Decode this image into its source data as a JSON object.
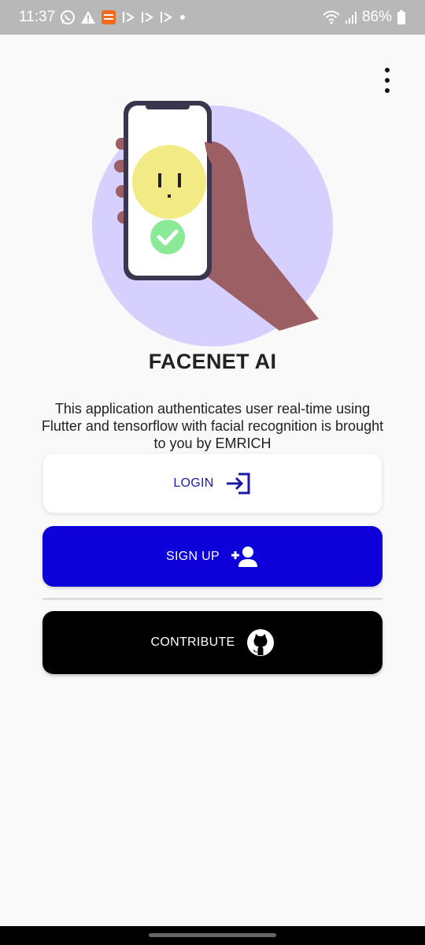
{
  "status_bar": {
    "time": "11:37",
    "battery": "86%",
    "icons": [
      "whatsapp-icon",
      "warning-icon",
      "app-notification-icon",
      "play-arrow-icon",
      "play-arrow-icon",
      "play-arrow-icon",
      "dot-icon",
      "wifi-icon",
      "signal-icon",
      "battery-icon"
    ]
  },
  "app_bar": {
    "menu_icon": "more-vert-icon"
  },
  "hero": {
    "illustration": "hand-holding-phone-face-check",
    "circle_color": "#d6d0ff",
    "face_color": "#f2ea84",
    "check_color": "#8bea97",
    "hand_color": "#9c5f63"
  },
  "title": "FACENET AI",
  "description": "This application authenticates user real-time using Flutter and tensorflow  with facial recognition is brought to you by EMRICH",
  "buttons": {
    "login": {
      "label": "LOGIN",
      "icon": "login-icon"
    },
    "signup": {
      "label": "SIGN UP",
      "icon": "person-add-icon"
    },
    "contribute": {
      "label": "CONTRIBUTE",
      "icon": "github-icon"
    }
  },
  "colors": {
    "primary": "#0d00d9",
    "login_text": "#1a1aa6",
    "contribute_bg": "#000000"
  }
}
